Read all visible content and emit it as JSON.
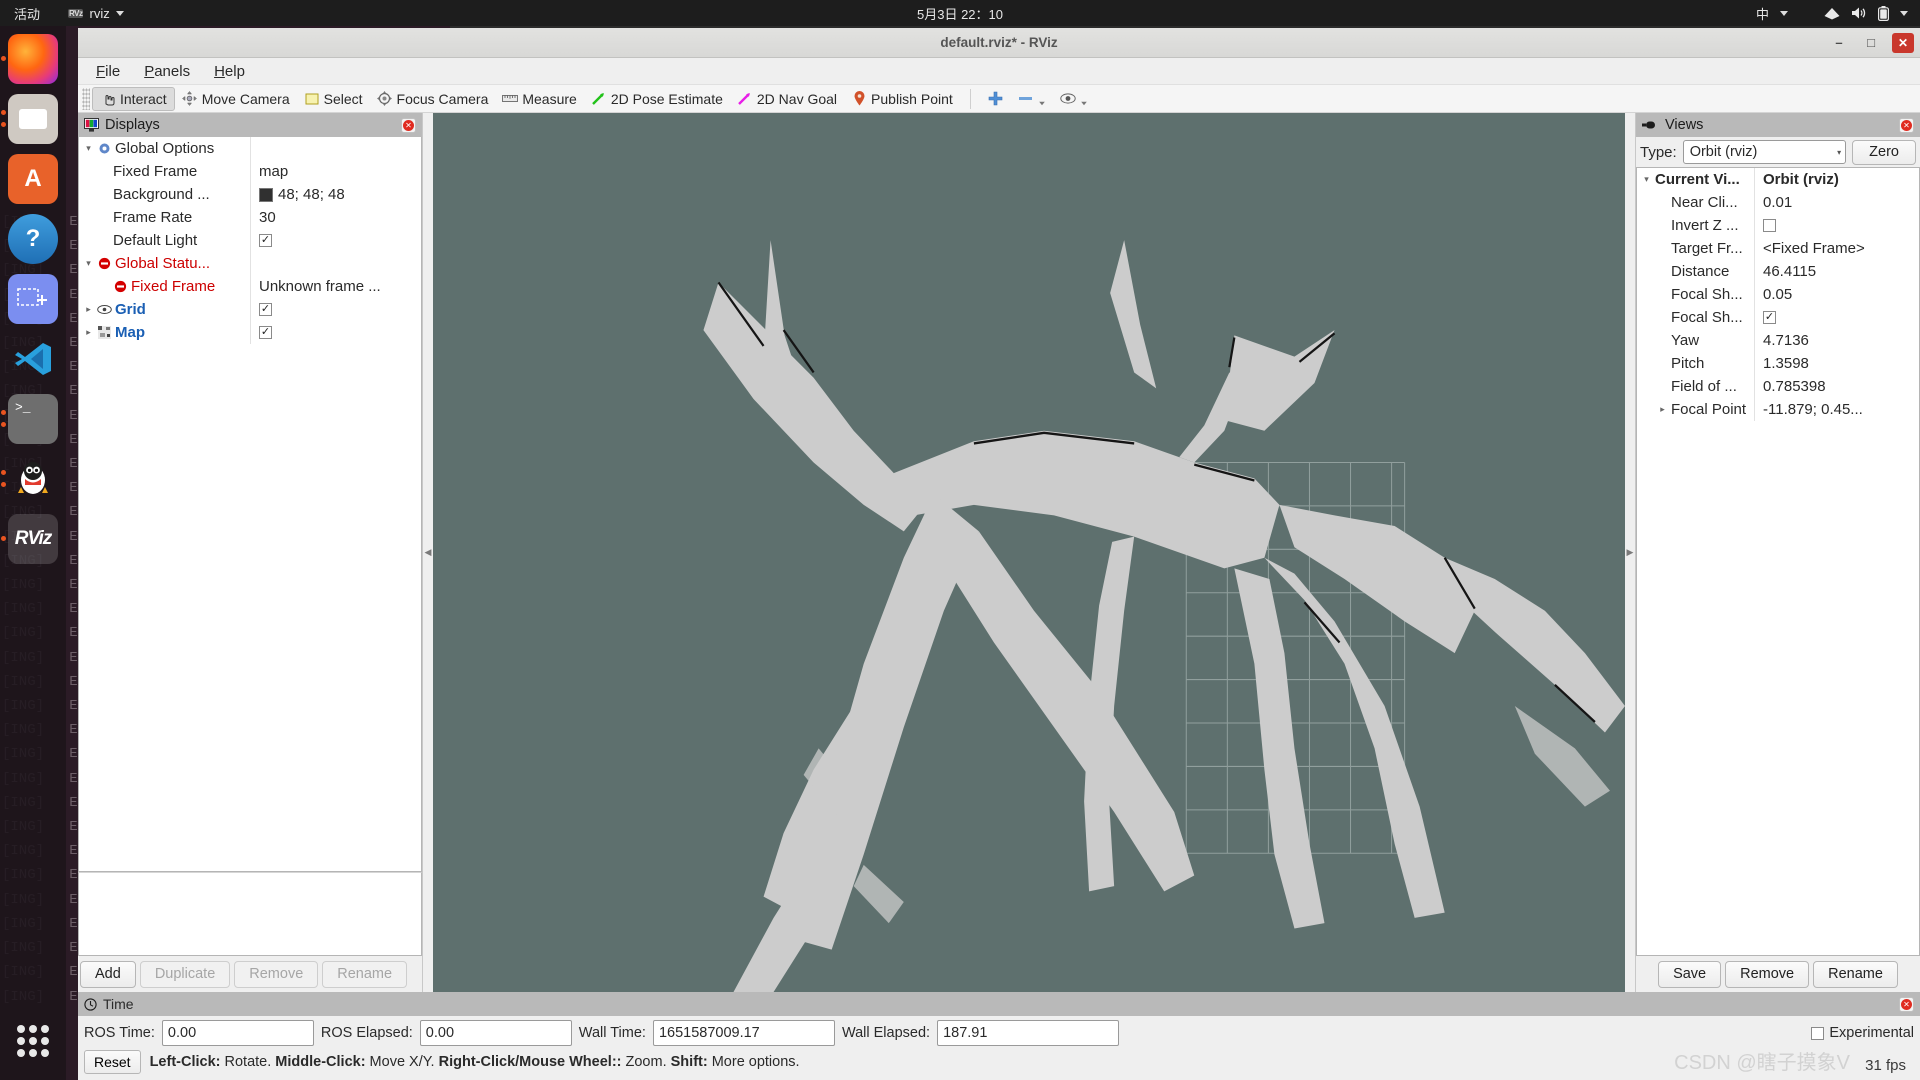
{
  "gnome": {
    "activities": "活动",
    "app_logo": "RVz",
    "app_name": "rviz",
    "clock": "5月3日  22：10",
    "tray": {
      "input_method": "中",
      "wifi_icon": "wifi-icon",
      "volume_icon": "volume-icon",
      "battery_icon": "battery-icon"
    }
  },
  "dock": {
    "items": [
      {
        "name": "firefox",
        "label": "Firefox",
        "glyph": ""
      },
      {
        "name": "files",
        "label": "Files",
        "glyph": ""
      },
      {
        "name": "ubuntu-software",
        "label": "Ubuntu Software",
        "glyph": "A"
      },
      {
        "name": "help",
        "label": "Help",
        "glyph": "?"
      },
      {
        "name": "screenshot",
        "label": "Screenshot",
        "glyph": "+"
      },
      {
        "name": "vscode",
        "label": "Visual Studio Code",
        "glyph": ""
      },
      {
        "name": "terminal",
        "label": "Terminal",
        "glyph": ">_"
      },
      {
        "name": "qq",
        "label": "QQ",
        "glyph": ""
      },
      {
        "name": "rviz",
        "label": "RViz",
        "glyph": "RViz"
      }
    ],
    "show_apps_label": "Show Applications"
  },
  "background_terminal": {
    "line": "[ING]   E",
    "lines": 33
  },
  "window": {
    "title": "default.rviz* - RViz",
    "minimize": "–",
    "maximize": "□",
    "close": "✕"
  },
  "menu": [
    {
      "name": "file",
      "label": "File",
      "mnemonic": "F",
      "rest": "ile"
    },
    {
      "name": "panels",
      "label": "Panels",
      "mnemonic": "P",
      "rest": "anels"
    },
    {
      "name": "help",
      "label": "Help",
      "mnemonic": "H",
      "rest": "elp"
    }
  ],
  "toolbar": {
    "buttons": [
      {
        "name": "interact",
        "label": "Interact",
        "icon": "hand-cursor-icon",
        "glyph": "☝",
        "active": true
      },
      {
        "name": "move-camera",
        "label": "Move Camera",
        "icon": "move-camera-icon",
        "glyph": "✥",
        "active": false
      },
      {
        "name": "select",
        "label": "Select",
        "icon": "select-rectangle-icon",
        "glyph": "▭",
        "active": false
      },
      {
        "name": "focus-camera",
        "label": "Focus Camera",
        "icon": "focus-camera-icon",
        "glyph": "◈",
        "active": false
      },
      {
        "name": "measure",
        "label": "Measure",
        "icon": "ruler-icon",
        "glyph": "▤",
        "active": false
      },
      {
        "name": "2d-pose-estimate",
        "label": "2D Pose Estimate",
        "icon": "green-arrow-icon",
        "glyph": "╱",
        "active": false
      },
      {
        "name": "2d-nav-goal",
        "label": "2D Nav Goal",
        "icon": "magenta-arrow-icon",
        "glyph": "╱",
        "active": false
      },
      {
        "name": "publish-point",
        "label": "Publish Point",
        "icon": "map-pin-icon",
        "glyph": "📍",
        "active": false
      }
    ],
    "extra": [
      {
        "name": "add-tool-button",
        "icon": "plus-icon",
        "glyph": "✛"
      },
      {
        "name": "remove-tool-button",
        "icon": "minus-icon",
        "glyph": "━"
      },
      {
        "name": "tool-properties-button",
        "icon": "eye-icon",
        "glyph": "◉"
      }
    ]
  },
  "displays": {
    "title": "Displays",
    "title_icon": "monitor-icon",
    "rows": [
      {
        "name": "global-options",
        "key": "Global Options",
        "value": "",
        "indent": 0,
        "expander": "▾",
        "icon": "gear-icon",
        "style": "plain",
        "value_type": "none"
      },
      {
        "name": "fixed-frame",
        "key": "Fixed Frame",
        "value": "map",
        "indent": 1,
        "expander": "",
        "icon": "",
        "style": "plain",
        "value_type": "text"
      },
      {
        "name": "background-color",
        "key": "Background ...",
        "value": "48; 48; 48",
        "indent": 1,
        "expander": "",
        "icon": "",
        "style": "plain",
        "value_type": "color"
      },
      {
        "name": "frame-rate",
        "key": "Frame Rate",
        "value": "30",
        "indent": 1,
        "expander": "",
        "icon": "",
        "style": "plain",
        "value_type": "text"
      },
      {
        "name": "default-light",
        "key": "Default Light",
        "value": "✓",
        "indent": 1,
        "expander": "",
        "icon": "",
        "style": "plain",
        "value_type": "checkbox"
      },
      {
        "name": "global-status",
        "key": "Global Statu...",
        "value": "",
        "indent": 0,
        "expander": "▾",
        "icon": "error-icon",
        "style": "red",
        "value_type": "none"
      },
      {
        "name": "status-fixed-frame",
        "key": "Fixed Frame",
        "value": "Unknown frame ...",
        "indent": 1,
        "expander": "",
        "icon": "error-icon",
        "style": "red",
        "value_type": "text"
      },
      {
        "name": "grid",
        "key": "Grid",
        "value": "✓",
        "indent": 0,
        "expander": "▸",
        "icon": "grid-icon",
        "style": "blue",
        "value_type": "checkbox"
      },
      {
        "name": "map",
        "key": "Map",
        "value": "✓",
        "indent": 0,
        "expander": "▸",
        "icon": "map-icon",
        "style": "blue",
        "value_type": "checkbox"
      }
    ],
    "buttons": [
      {
        "name": "add-display-button",
        "label": "Add",
        "disabled": false
      },
      {
        "name": "duplicate-display-button",
        "label": "Duplicate",
        "disabled": true
      },
      {
        "name": "remove-display-button",
        "label": "Remove",
        "disabled": true
      },
      {
        "name": "rename-display-button",
        "label": "Rename",
        "disabled": true
      }
    ]
  },
  "views": {
    "title": "Views",
    "title_icon": "camera-icon",
    "type_label": "Type:",
    "type_value": "Orbit (rviz)",
    "zero_label": "Zero",
    "rows": [
      {
        "name": "current-view",
        "key": "Current Vi...",
        "value": "Orbit (rviz)",
        "indent": 0,
        "expander": "▾",
        "style": "bold",
        "value_type": "text"
      },
      {
        "name": "near-clip-distance",
        "key": "Near Cli...",
        "value": "0.01",
        "indent": 1,
        "expander": "",
        "style": "plain",
        "value_type": "text"
      },
      {
        "name": "invert-z-axis",
        "key": "Invert Z ...",
        "value": "",
        "indent": 1,
        "expander": "",
        "style": "plain",
        "value_type": "checkbox-off"
      },
      {
        "name": "target-frame",
        "key": "Target Fr...",
        "value": "<Fixed Frame>",
        "indent": 1,
        "expander": "",
        "style": "plain",
        "value_type": "text"
      },
      {
        "name": "distance",
        "key": "Distance",
        "value": "46.4115",
        "indent": 1,
        "expander": "",
        "style": "plain",
        "value_type": "text"
      },
      {
        "name": "focal-shape-size",
        "key": "Focal Sh...",
        "value": "0.05",
        "indent": 1,
        "expander": "",
        "style": "plain",
        "value_type": "text"
      },
      {
        "name": "focal-shape-fixed-size",
        "key": "Focal Sh...",
        "value": "✓",
        "indent": 1,
        "expander": "",
        "style": "plain",
        "value_type": "checkbox"
      },
      {
        "name": "yaw",
        "key": "Yaw",
        "value": "4.7136",
        "indent": 1,
        "expander": "",
        "style": "plain",
        "value_type": "text"
      },
      {
        "name": "pitch",
        "key": "Pitch",
        "value": "1.3598",
        "indent": 1,
        "expander": "",
        "style": "plain",
        "value_type": "text"
      },
      {
        "name": "field-of-view",
        "key": "Field of ...",
        "value": "0.785398",
        "indent": 1,
        "expander": "",
        "style": "plain",
        "value_type": "text"
      },
      {
        "name": "focal-point",
        "key": "Focal Point",
        "value": "-11.879; 0.45...",
        "indent": 1,
        "expander": "▸",
        "style": "plain",
        "value_type": "text"
      }
    ],
    "buttons": [
      {
        "name": "save-view-button",
        "label": "Save"
      },
      {
        "name": "remove-view-button",
        "label": "Remove"
      },
      {
        "name": "rename-view-button",
        "label": "Rename"
      }
    ]
  },
  "time": {
    "title": "Time",
    "title_icon": "clock-icon",
    "fields": [
      {
        "name": "ros-time",
        "label": "ROS Time:",
        "value": "0.00",
        "width": "tf-in-1"
      },
      {
        "name": "ros-elapsed",
        "label": "ROS Elapsed:",
        "value": "0.00",
        "width": "tf-in-2"
      },
      {
        "name": "wall-time",
        "label": "Wall Time:",
        "value": "1651587009.17",
        "width": "tf-in-3"
      },
      {
        "name": "wall-elapsed",
        "label": "Wall Elapsed:",
        "value": "187.91",
        "width": "tf-in-4"
      }
    ],
    "reset_label": "Reset",
    "hint_parts": [
      {
        "bold": "Left-Click:",
        "plain": " Rotate. "
      },
      {
        "bold": "Middle-Click:",
        "plain": " Move X/Y. "
      },
      {
        "bold": "Right-Click/Mouse Wheel::",
        "plain": " Zoom. "
      },
      {
        "bold": "Shift:",
        "plain": " More options."
      }
    ],
    "experimental_label": "Experimental",
    "fps": "31 fps",
    "watermark": "CSDN @瞎子摸象V"
  },
  "viewport": {
    "background_color": "#5e706e",
    "map_free_color": "#cccccc",
    "map_occupied_color": "#1a1a1a",
    "grid_color": "#9aa8a6"
  }
}
